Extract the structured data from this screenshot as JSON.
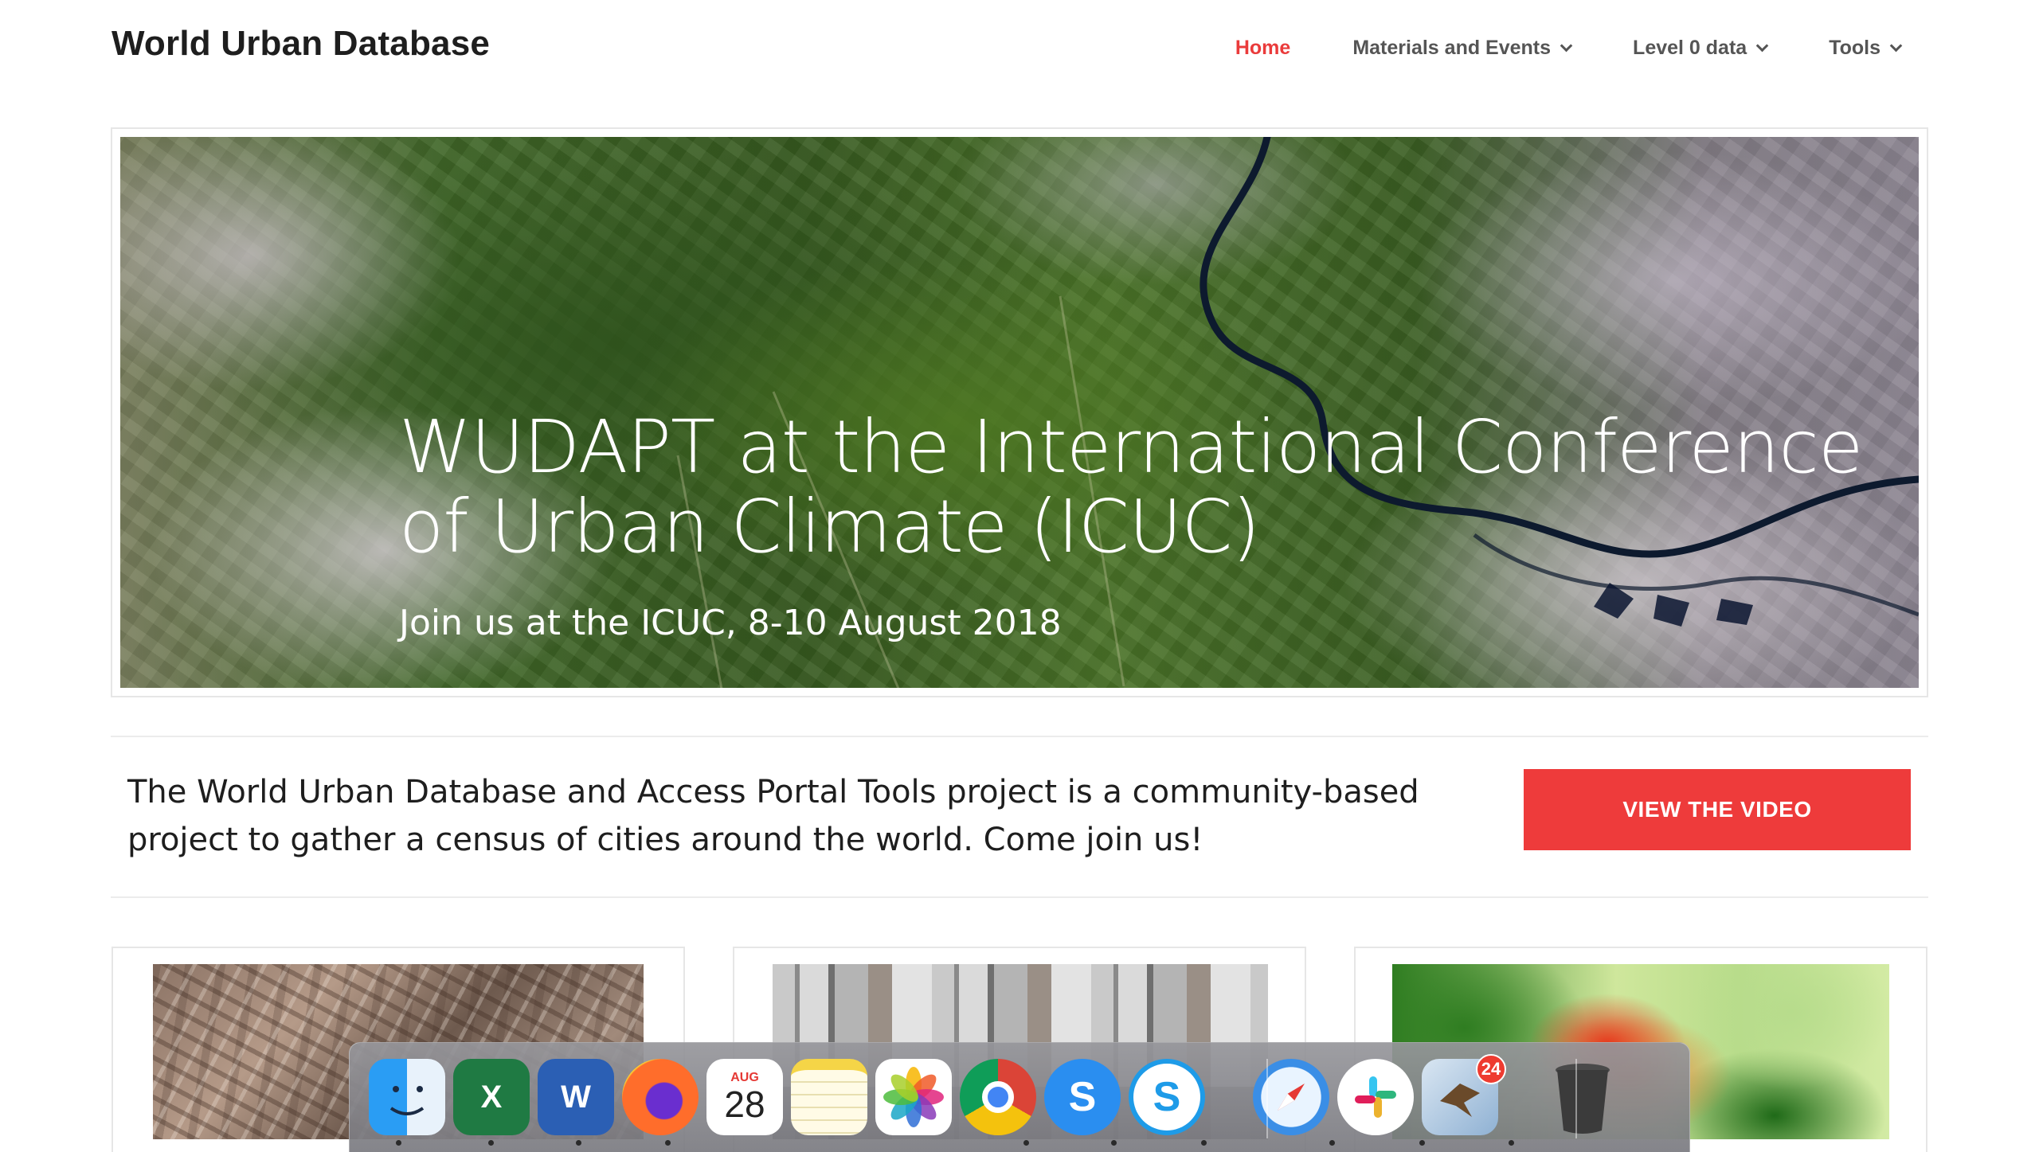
{
  "site": {
    "title": "World Urban Database"
  },
  "nav": {
    "items": [
      {
        "label": "Home",
        "active": true,
        "has_dropdown": false
      },
      {
        "label": "Materials and Events",
        "active": false,
        "has_dropdown": true
      },
      {
        "label": "Level 0 data",
        "active": false,
        "has_dropdown": true
      },
      {
        "label": "Tools",
        "active": false,
        "has_dropdown": true
      }
    ]
  },
  "hero": {
    "title": "WUDAPT at the International Conference of Urban Climate (ICUC)",
    "subtitle": "Join us at the ICUC, 8-10 August 2018",
    "slides": 3,
    "active_slide": 2
  },
  "intro": {
    "text": "The World Urban Database and Access Portal Tools project is a community-based project to gather a census of cities around the world. Come join us!",
    "button_label": "VIEW THE VIDEO"
  },
  "cards": [
    {
      "image": "aerial-city-image"
    },
    {
      "image": "city-buildings-image"
    },
    {
      "image": "land-cover-map-image"
    }
  ],
  "dock": {
    "apps": [
      {
        "name": "Finder",
        "icon": "finder-icon",
        "running": true
      },
      {
        "name": "Microsoft Excel",
        "icon": "excel-icon",
        "running": true
      },
      {
        "name": "Microsoft Word",
        "icon": "word-icon",
        "running": true
      },
      {
        "name": "Firefox",
        "icon": "firefox-icon",
        "running": true
      },
      {
        "name": "Calendar",
        "icon": "calendar-icon",
        "running": false,
        "month": "AUG",
        "day": "28"
      },
      {
        "name": "Notes",
        "icon": "notes-icon",
        "running": false
      },
      {
        "name": "Photos",
        "icon": "photos-icon",
        "running": false
      },
      {
        "name": "Google Chrome",
        "icon": "chrome-icon",
        "running": true
      },
      {
        "name": "Skype for Business",
        "icon": "skype-business-icon",
        "running": true
      },
      {
        "name": "Skype",
        "icon": "skype-icon",
        "running": true
      },
      {
        "name": "Safari",
        "icon": "safari-icon",
        "running": true
      },
      {
        "name": "Slack",
        "icon": "slack-icon",
        "running": true
      },
      {
        "name": "Mail",
        "icon": "mail-icon",
        "running": true,
        "badge": "24"
      },
      {
        "name": "Trash",
        "icon": "trash-icon",
        "running": false
      }
    ]
  },
  "colors": {
    "accent": "#ee3b3b",
    "nav_text": "#555555",
    "title_text": "#1e1e1e"
  }
}
